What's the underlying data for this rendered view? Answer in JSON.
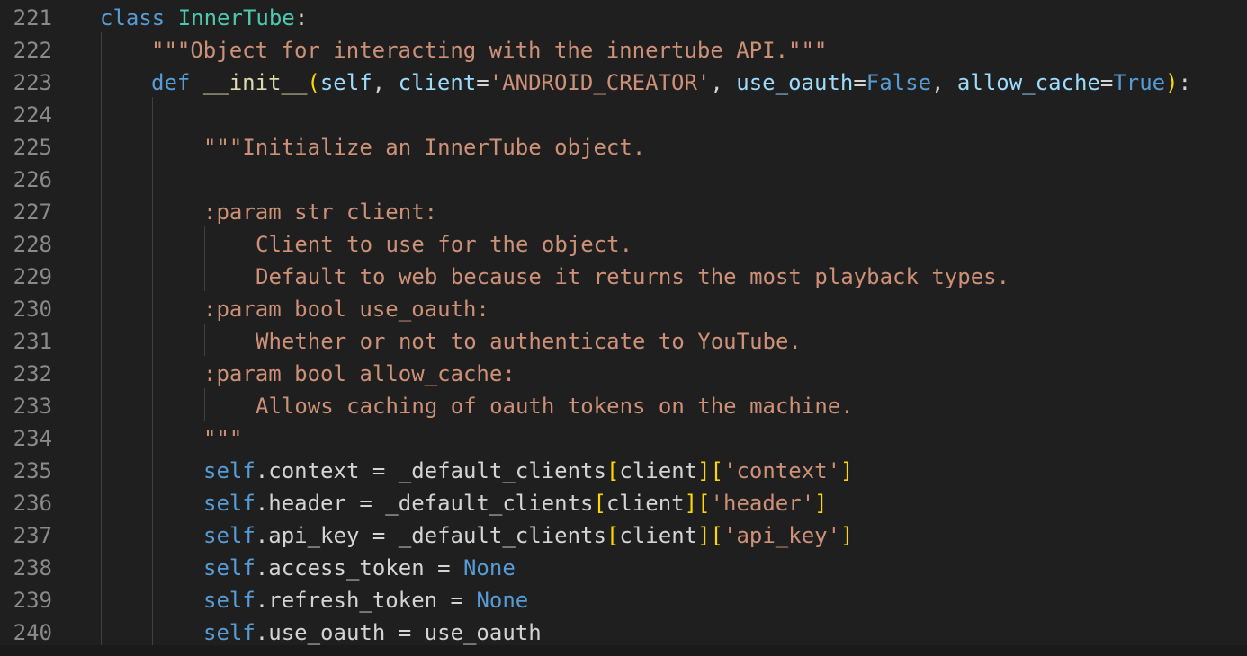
{
  "editor": {
    "lines": [
      {
        "num": "221"
      },
      {
        "num": "222"
      },
      {
        "num": "223"
      },
      {
        "num": "224"
      },
      {
        "num": "225"
      },
      {
        "num": "226"
      },
      {
        "num": "227"
      },
      {
        "num": "228"
      },
      {
        "num": "229"
      },
      {
        "num": "230"
      },
      {
        "num": "231"
      },
      {
        "num": "232"
      },
      {
        "num": "233"
      },
      {
        "num": "234"
      },
      {
        "num": "235"
      },
      {
        "num": "236"
      },
      {
        "num": "237"
      },
      {
        "num": "238"
      },
      {
        "num": "239"
      },
      {
        "num": "240"
      }
    ],
    "tokens": {
      "l221": {
        "kw": "class",
        "name": "InnerTube",
        "colon": ":"
      },
      "l222": {
        "doc": "\"\"\"Object for interacting with the innertube API.\"\"\""
      },
      "l223": {
        "def": "def",
        "fname": "__init__",
        "open": "(",
        "self": "self",
        "comma1": ", ",
        "p1": "client",
        "eq1": "=",
        "v1": "'ANDROID_CREATOR'",
        "comma2": ", ",
        "p2": "use_oauth",
        "eq2": "=",
        "v2": "False",
        "comma3": ", ",
        "p3": "allow_cache",
        "eq3": "=",
        "v3": "True",
        "close": ")",
        "colon": ":"
      },
      "l225": {
        "doc": "\"\"\"Initialize an InnerTube object."
      },
      "l227": {
        "doc": ":param str client:"
      },
      "l228": {
        "doc": "Client to use for the object."
      },
      "l229": {
        "doc": "Default to web because it returns the most playback types."
      },
      "l230": {
        "doc": ":param bool use_oauth:"
      },
      "l231": {
        "doc": "Whether or not to authenticate to YouTube."
      },
      "l232": {
        "doc": ":param bool allow_cache:"
      },
      "l233": {
        "doc": "Allows caching of oauth tokens on the machine."
      },
      "l234": {
        "doc": "\"\"\""
      },
      "l235": {
        "self": "self",
        "attr": ".context = _default_clients",
        "ob1": "[",
        "idx": "client",
        "cb1": "]",
        "ob2": "[",
        "key": "'context'",
        "cb2": "]"
      },
      "l236": {
        "self": "self",
        "attr": ".header = _default_clients",
        "ob1": "[",
        "idx": "client",
        "cb1": "]",
        "ob2": "[",
        "key": "'header'",
        "cb2": "]"
      },
      "l237": {
        "self": "self",
        "attr": ".api_key = _default_clients",
        "ob1": "[",
        "idx": "client",
        "cb1": "]",
        "ob2": "[",
        "key": "'api_key'",
        "cb2": "]"
      },
      "l238": {
        "self": "self",
        "attr": ".access_token = ",
        "val": "None"
      },
      "l239": {
        "self": "self",
        "attr": ".refresh_token = ",
        "val": "None"
      },
      "l240": {
        "self": "self",
        "attr": ".use_oauth = use_oauth"
      }
    }
  }
}
